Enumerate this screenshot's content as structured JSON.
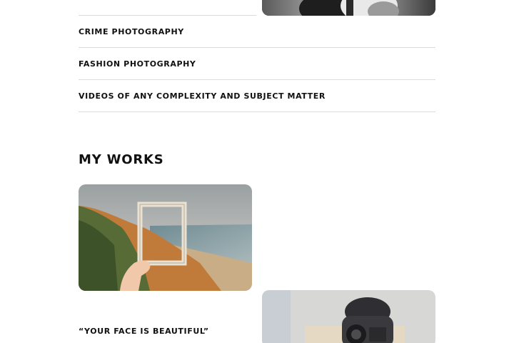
{
  "services": {
    "items": [
      {
        "label": "CRIME PHOTOGRAPHY"
      },
      {
        "label": "FASHION PHOTOGRAPHY"
      },
      {
        "label": "VIDEOS OF ANY COMPLEXITY AND SUBJECT MATTER"
      }
    ]
  },
  "works": {
    "title": "MY WORKS",
    "items": [
      {
        "image": "photo-hand-holding-frame-at-coast"
      },
      {
        "image": "photo-photographer-with-camera",
        "caption": "“YOUR FACE IS BEAUTIFUL”"
      }
    ]
  },
  "colors": {
    "text": "#111111",
    "divider": "#dcdcdc",
    "background": "#ffffff"
  }
}
